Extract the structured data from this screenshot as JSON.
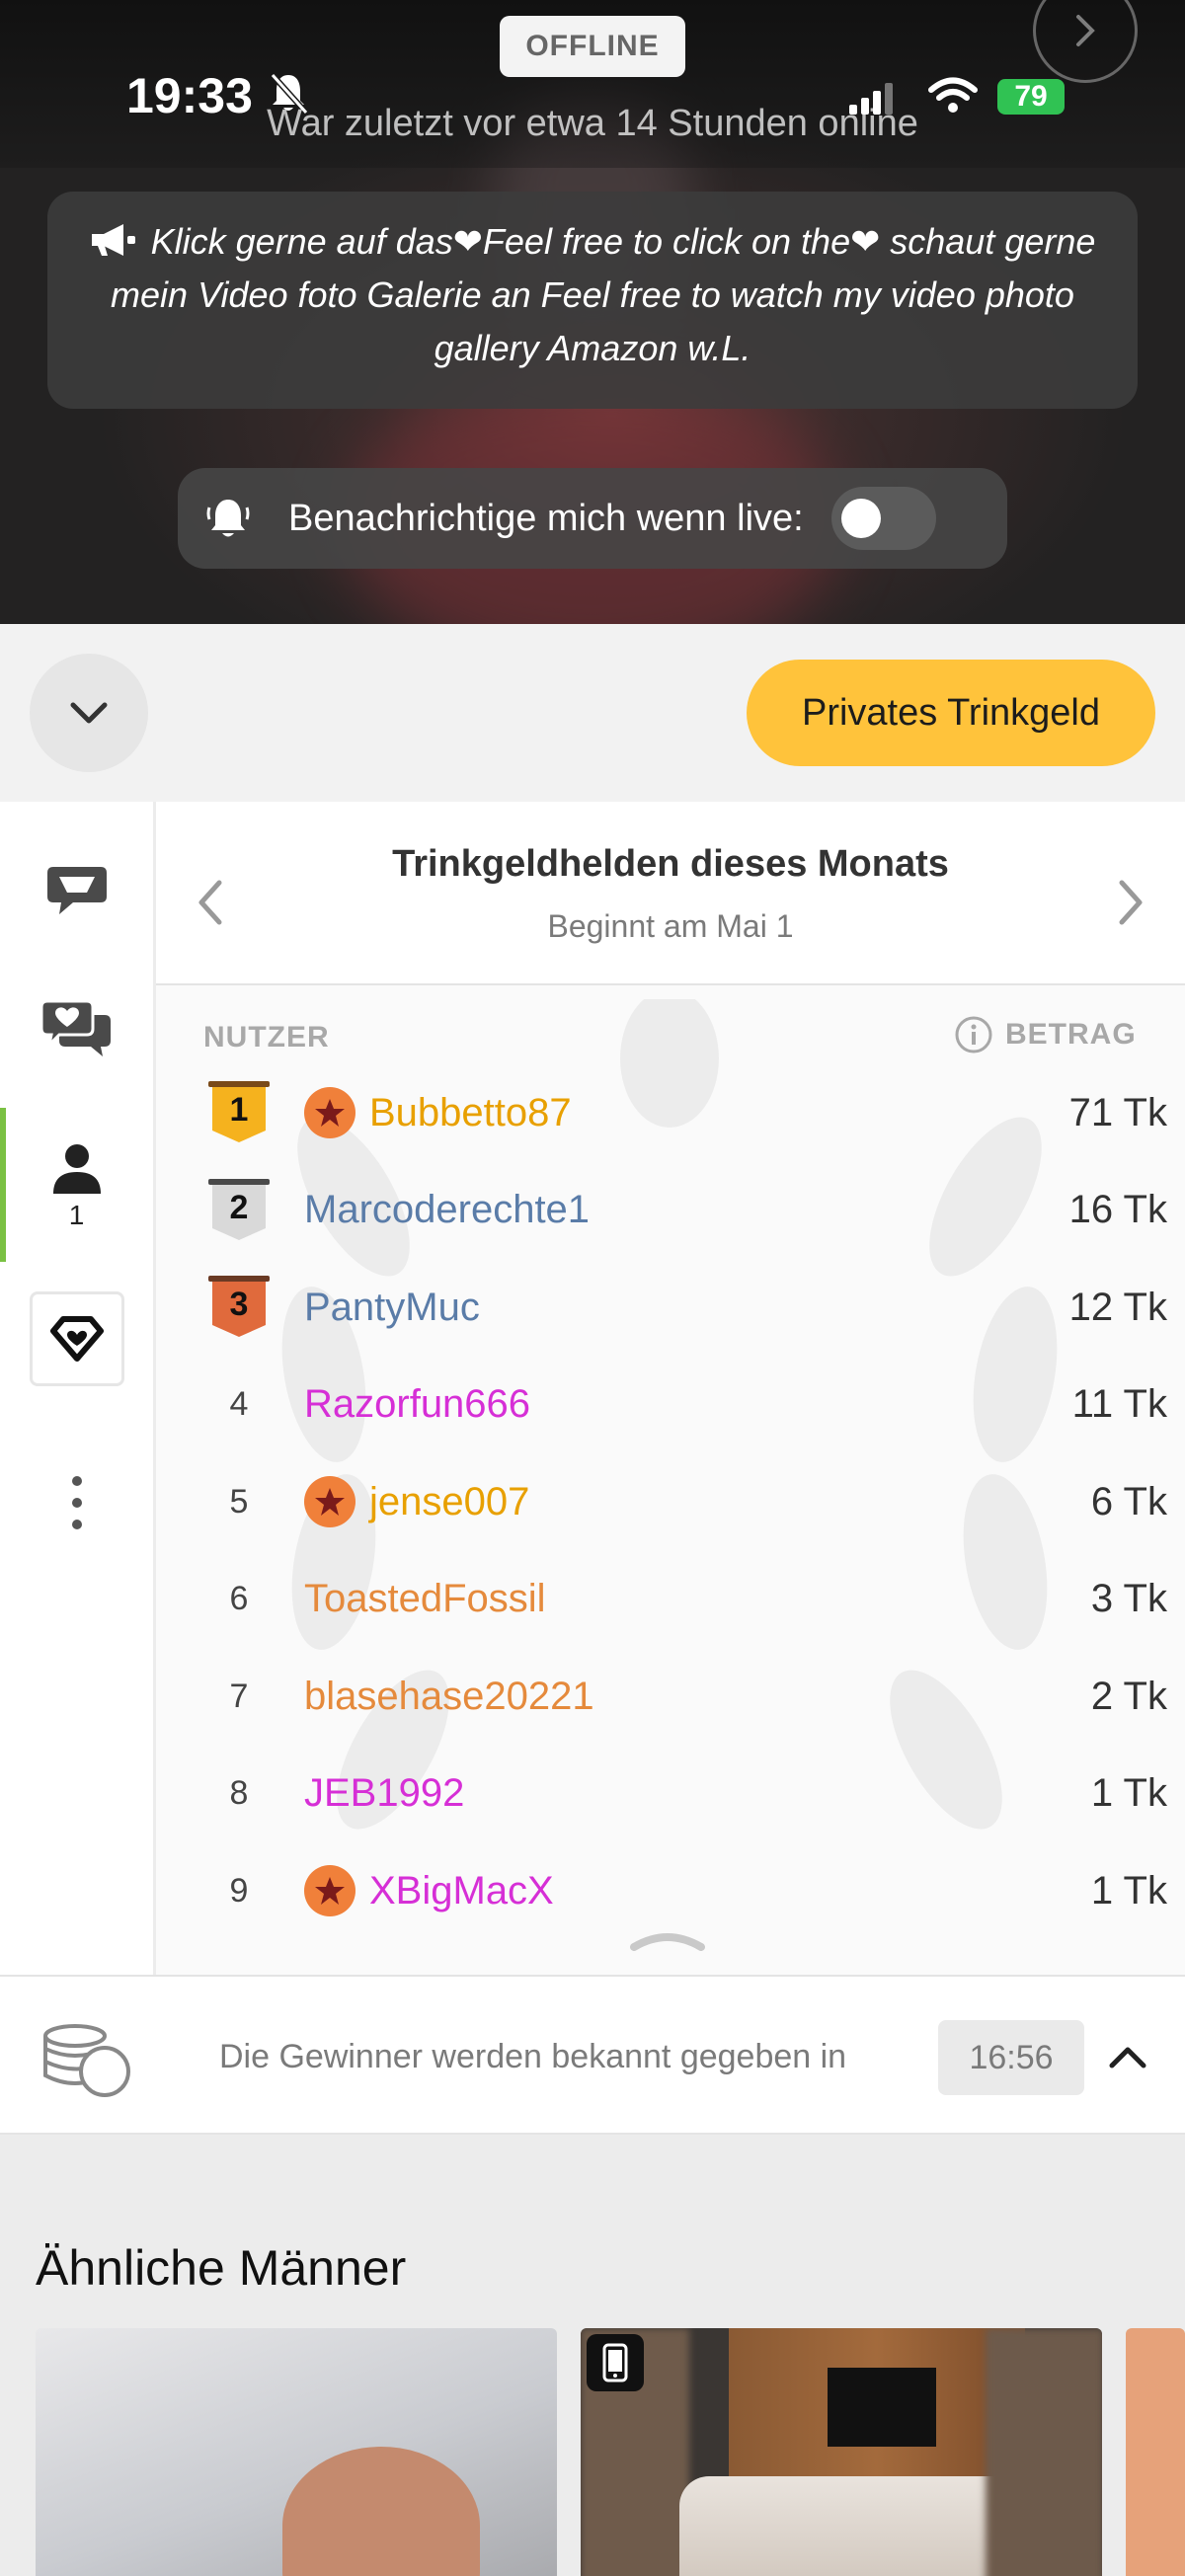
{
  "status_bar": {
    "time": "19:33",
    "battery": "79"
  },
  "hero": {
    "offline_badge": "OFFLINE",
    "last_online": "War zuletzt vor etwa 14 Stunden online",
    "motd": "Klick gerne auf das❤Feel free to click on the❤ schaut gerne mein Video foto Galerie an Feel free to watch my video photo gallery Amazon w.L.",
    "notify_label": "Benachrichtige mich wenn live:",
    "notify_enabled": false
  },
  "actionbar": {
    "tip_button": "Privates Trinkgeld"
  },
  "sidebar": {
    "users_count": "1"
  },
  "leaderboard": {
    "title": "Trinkgeldhelden dieses Monats",
    "subtitle": "Beginnt am Mai 1",
    "col_user": "NUTZER",
    "col_amount": "BETRAG",
    "rows": [
      {
        "rank": "1",
        "name": "Bubbetto87",
        "amount": "71 Tk",
        "color": "#e8a000",
        "star": true,
        "medal": "gold"
      },
      {
        "rank": "2",
        "name": "Marcoderechte1",
        "amount": "16 Tk",
        "color": "#5a7ca8",
        "star": false,
        "medal": "silver"
      },
      {
        "rank": "3",
        "name": "PantyMuc",
        "amount": "12 Tk",
        "color": "#5a7ca8",
        "star": false,
        "medal": "bronze"
      },
      {
        "rank": "4",
        "name": "Razorfun666",
        "amount": "11 Tk",
        "color": "#d62fd6",
        "star": false,
        "medal": ""
      },
      {
        "rank": "5",
        "name": "jense007",
        "amount": "6 Tk",
        "color": "#e8a000",
        "star": true,
        "medal": ""
      },
      {
        "rank": "6",
        "name": "ToastedFossil",
        "amount": "3 Tk",
        "color": "#e58a3c",
        "star": false,
        "medal": ""
      },
      {
        "rank": "7",
        "name": "blasehase20221",
        "amount": "2 Tk",
        "color": "#e58a3c",
        "star": false,
        "medal": ""
      },
      {
        "rank": "8",
        "name": "JEB1992",
        "amount": "1 Tk",
        "color": "#d62fd6",
        "star": false,
        "medal": ""
      },
      {
        "rank": "9",
        "name": "XBigMacX",
        "amount": "1 Tk",
        "color": "#d62fd6",
        "star": true,
        "medal": ""
      }
    ]
  },
  "winner_bar": {
    "text": "Die Gewinner werden bekannt gegeben in",
    "timer": "16:56"
  },
  "similar": {
    "title": "Ähnliche Männer"
  }
}
